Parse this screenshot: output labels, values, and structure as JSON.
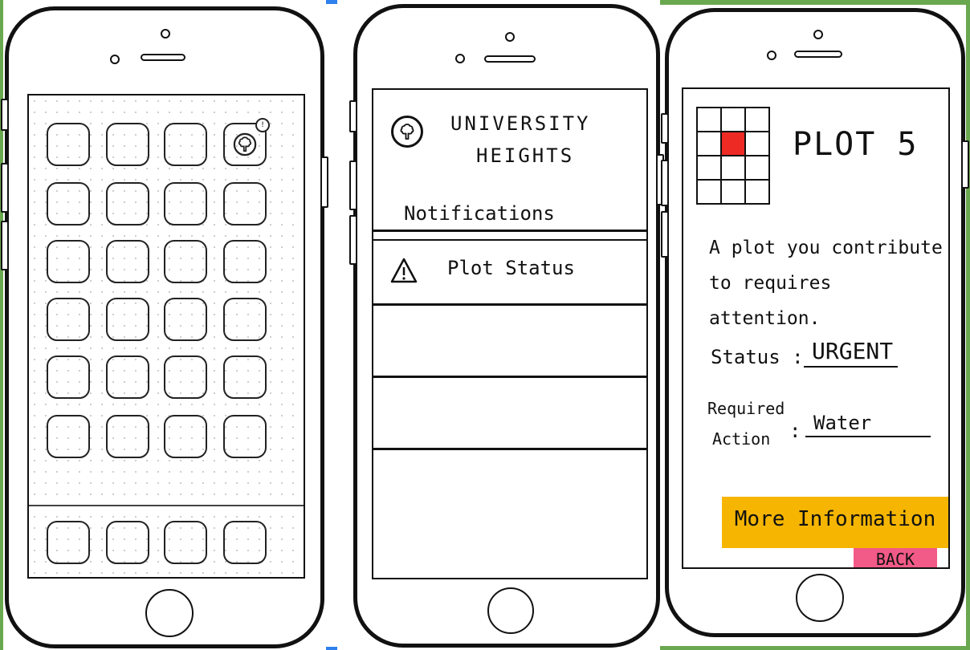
{
  "screen_home": {
    "badge_count": "!"
  },
  "screen_notifications": {
    "org_name_line1": "UNIVERSITY",
    "org_name_line2": "HEIGHTS",
    "section_title": "Notifications",
    "notification_item": "Plot Status"
  },
  "screen_plot": {
    "title": "PLOT 5",
    "message_line1": "A plot you contribute",
    "message_line2": "to requires attention.",
    "status_label": "Status :",
    "status_value": "URGENT",
    "required_action_label_line1": "Required",
    "required_action_label_line2": "Action",
    "required_action_colon": ":",
    "required_action_value": "Water",
    "more_info_button": "More Information",
    "back_button": "BACK"
  },
  "colors": {
    "highlight_plot": "#ee2a24",
    "more_info_bg": "#f5b500",
    "back_bg": "#f25a87",
    "frame_green": "#6aa84f"
  },
  "icons": {
    "app_logo": "tree-icon",
    "notification": "warning-triangle-icon"
  }
}
